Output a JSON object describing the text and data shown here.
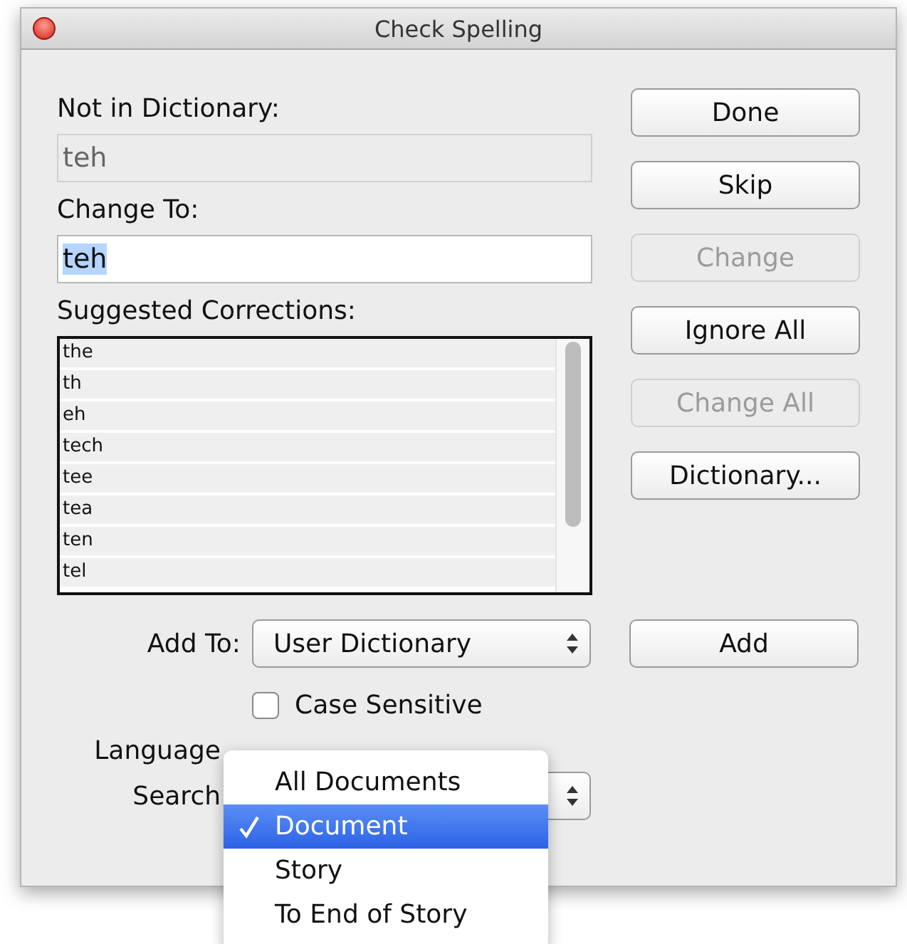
{
  "window": {
    "title": "Check Spelling"
  },
  "not_in_dictionary": {
    "label": "Not in Dictionary:",
    "value": "teh"
  },
  "change_to": {
    "label": "Change To:",
    "value": "teh",
    "text_selected": true
  },
  "suggestions": {
    "label": "Suggested Corrections:",
    "items": [
      "the",
      "th",
      "eh",
      "tech",
      "tee",
      "tea",
      "ten",
      "tel"
    ]
  },
  "buttons": [
    {
      "label": "Done",
      "disabled": false
    },
    {
      "label": "Skip",
      "disabled": false
    },
    {
      "label": "Change",
      "disabled": true
    },
    {
      "label": "Ignore All",
      "disabled": false
    },
    {
      "label": "Change All",
      "disabled": true
    },
    {
      "label": "Dictionary...",
      "disabled": false
    }
  ],
  "add_to": {
    "label": "Add To:",
    "value": "User Dictionary"
  },
  "add_button": {
    "label": "Add"
  },
  "case_sensitive": {
    "label": "Case Sensitive",
    "checked": false
  },
  "language": {
    "label": "Language"
  },
  "search": {
    "label": "Search"
  },
  "search_menu": {
    "items": [
      {
        "label": "All Documents",
        "selected": false
      },
      {
        "label": "Document",
        "selected": true
      },
      {
        "label": "Story",
        "selected": false
      },
      {
        "label": "To End of Story",
        "selected": false
      }
    ]
  }
}
